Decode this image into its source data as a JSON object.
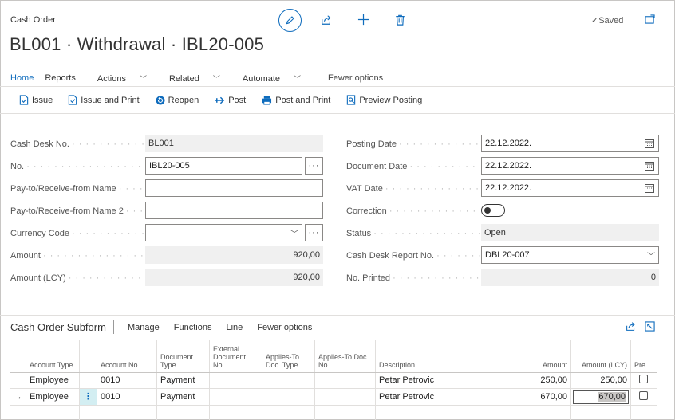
{
  "header": {
    "page_type": "Cash Order",
    "title": "BL001 · Withdrawal · IBL20-005",
    "saved_label": "Saved"
  },
  "nav": {
    "home": "Home",
    "reports": "Reports",
    "actions": "Actions",
    "related": "Related",
    "automate": "Automate",
    "fewer_options": "Fewer options"
  },
  "action_bar": {
    "issue": "Issue",
    "issue_and_print": "Issue and Print",
    "reopen": "Reopen",
    "post": "Post",
    "post_and_print": "Post and Print",
    "preview_posting": "Preview Posting"
  },
  "form": {
    "cash_desk_no": {
      "label": "Cash Desk No.",
      "value": "BL001"
    },
    "no": {
      "label": "No.",
      "value": "IBL20-005"
    },
    "pay_to_name": {
      "label": "Pay-to/Receive-from Name",
      "value": ""
    },
    "pay_to_name_2": {
      "label": "Pay-to/Receive-from Name 2",
      "value": ""
    },
    "currency_code": {
      "label": "Currency Code",
      "value": ""
    },
    "amount": {
      "label": "Amount",
      "value": "920,00"
    },
    "amount_lcy": {
      "label": "Amount (LCY)",
      "value": "920,00"
    },
    "posting_date": {
      "label": "Posting Date",
      "value": "22.12.2022."
    },
    "document_date": {
      "label": "Document Date",
      "value": "22.12.2022."
    },
    "vat_date": {
      "label": "VAT Date",
      "value": "22.12.2022."
    },
    "correction": {
      "label": "Correction",
      "value": false
    },
    "status": {
      "label": "Status",
      "value": "Open"
    },
    "cash_desk_report_no": {
      "label": "Cash Desk Report No.",
      "value": "DBL20-007"
    },
    "no_printed": {
      "label": "No. Printed",
      "value": "0"
    }
  },
  "subform": {
    "title": "Cash Order Subform",
    "menu": [
      "Manage",
      "Functions",
      "Line",
      "Fewer options"
    ],
    "columns": [
      "Account Type",
      "Account No.",
      "Document Type",
      "External Document No.",
      "Applies-To Doc. Type",
      "Applies-To Doc. No.",
      "Description",
      "Amount",
      "Amount (LCY)",
      "Pre..."
    ],
    "rows": [
      {
        "account_type": "Employee",
        "account_no": "0010",
        "document_type": "Payment",
        "external_doc_no": "",
        "applies_to_type": "",
        "applies_to_no": "",
        "description": "Petar  Petrovic",
        "amount": "250,00",
        "amount_lcy": "250,00",
        "selected": false
      },
      {
        "account_type": "Employee",
        "account_no": "0010",
        "document_type": "Payment",
        "external_doc_no": "",
        "applies_to_type": "",
        "applies_to_no": "",
        "description": "Petar  Petrovic",
        "amount": "670,00",
        "amount_lcy": "670,00",
        "selected": true
      }
    ]
  },
  "colors": {
    "accent": "#0f6cbd",
    "readonly_bg": "#f0f0f0",
    "border": "#8a8886"
  },
  "icons": [
    "edit-icon",
    "share-icon",
    "plus-icon",
    "delete-icon",
    "checkmark-icon",
    "popout-icon",
    "calendar-icon",
    "chevron-down-icon",
    "ellipsis-icon"
  ]
}
